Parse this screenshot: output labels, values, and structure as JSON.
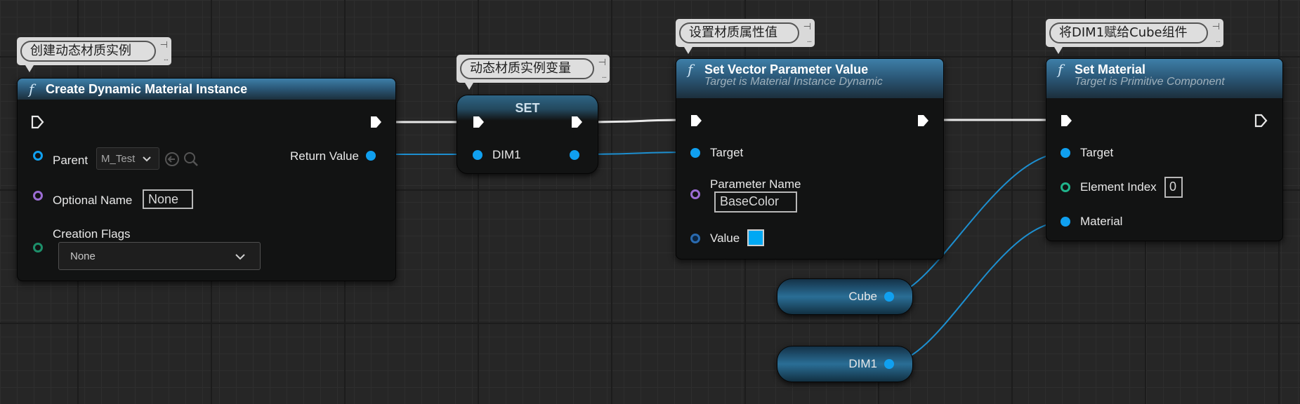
{
  "comments": {
    "create": "创建动态材质实例",
    "var": "动态材质实例变量",
    "setparam": "设置材质属性值",
    "assign": "将DIM1赋给Cube组件"
  },
  "create_node": {
    "title": "Create Dynamic Material Instance",
    "parent_label": "Parent",
    "parent_value": "M_Test",
    "optional_name_label": "Optional Name",
    "optional_name_value": "None",
    "creation_flags_label": "Creation Flags",
    "creation_flags_value": "None",
    "return_label": "Return Value"
  },
  "set_node": {
    "title": "SET",
    "var_label": "DIM1"
  },
  "vector_node": {
    "title": "Set Vector Parameter Value",
    "subtitle": "Target is Material Instance Dynamic",
    "target_label": "Target",
    "param_name_label": "Parameter Name",
    "param_name_value": "BaseColor",
    "value_label": "Value",
    "value_color": "#00a8f3"
  },
  "material_node": {
    "title": "Set Material",
    "subtitle": "Target is Primitive Component",
    "target_label": "Target",
    "element_index_label": "Element Index",
    "element_index_value": "0",
    "material_label": "Material"
  },
  "cube_var": {
    "label": "Cube"
  },
  "dim1_var": {
    "label": "DIM1"
  },
  "colors": {
    "object_pin": "#10a0f0",
    "name_pin": "#9b6cd3",
    "int_pin": "#20b38b",
    "header": "#2a5675"
  }
}
